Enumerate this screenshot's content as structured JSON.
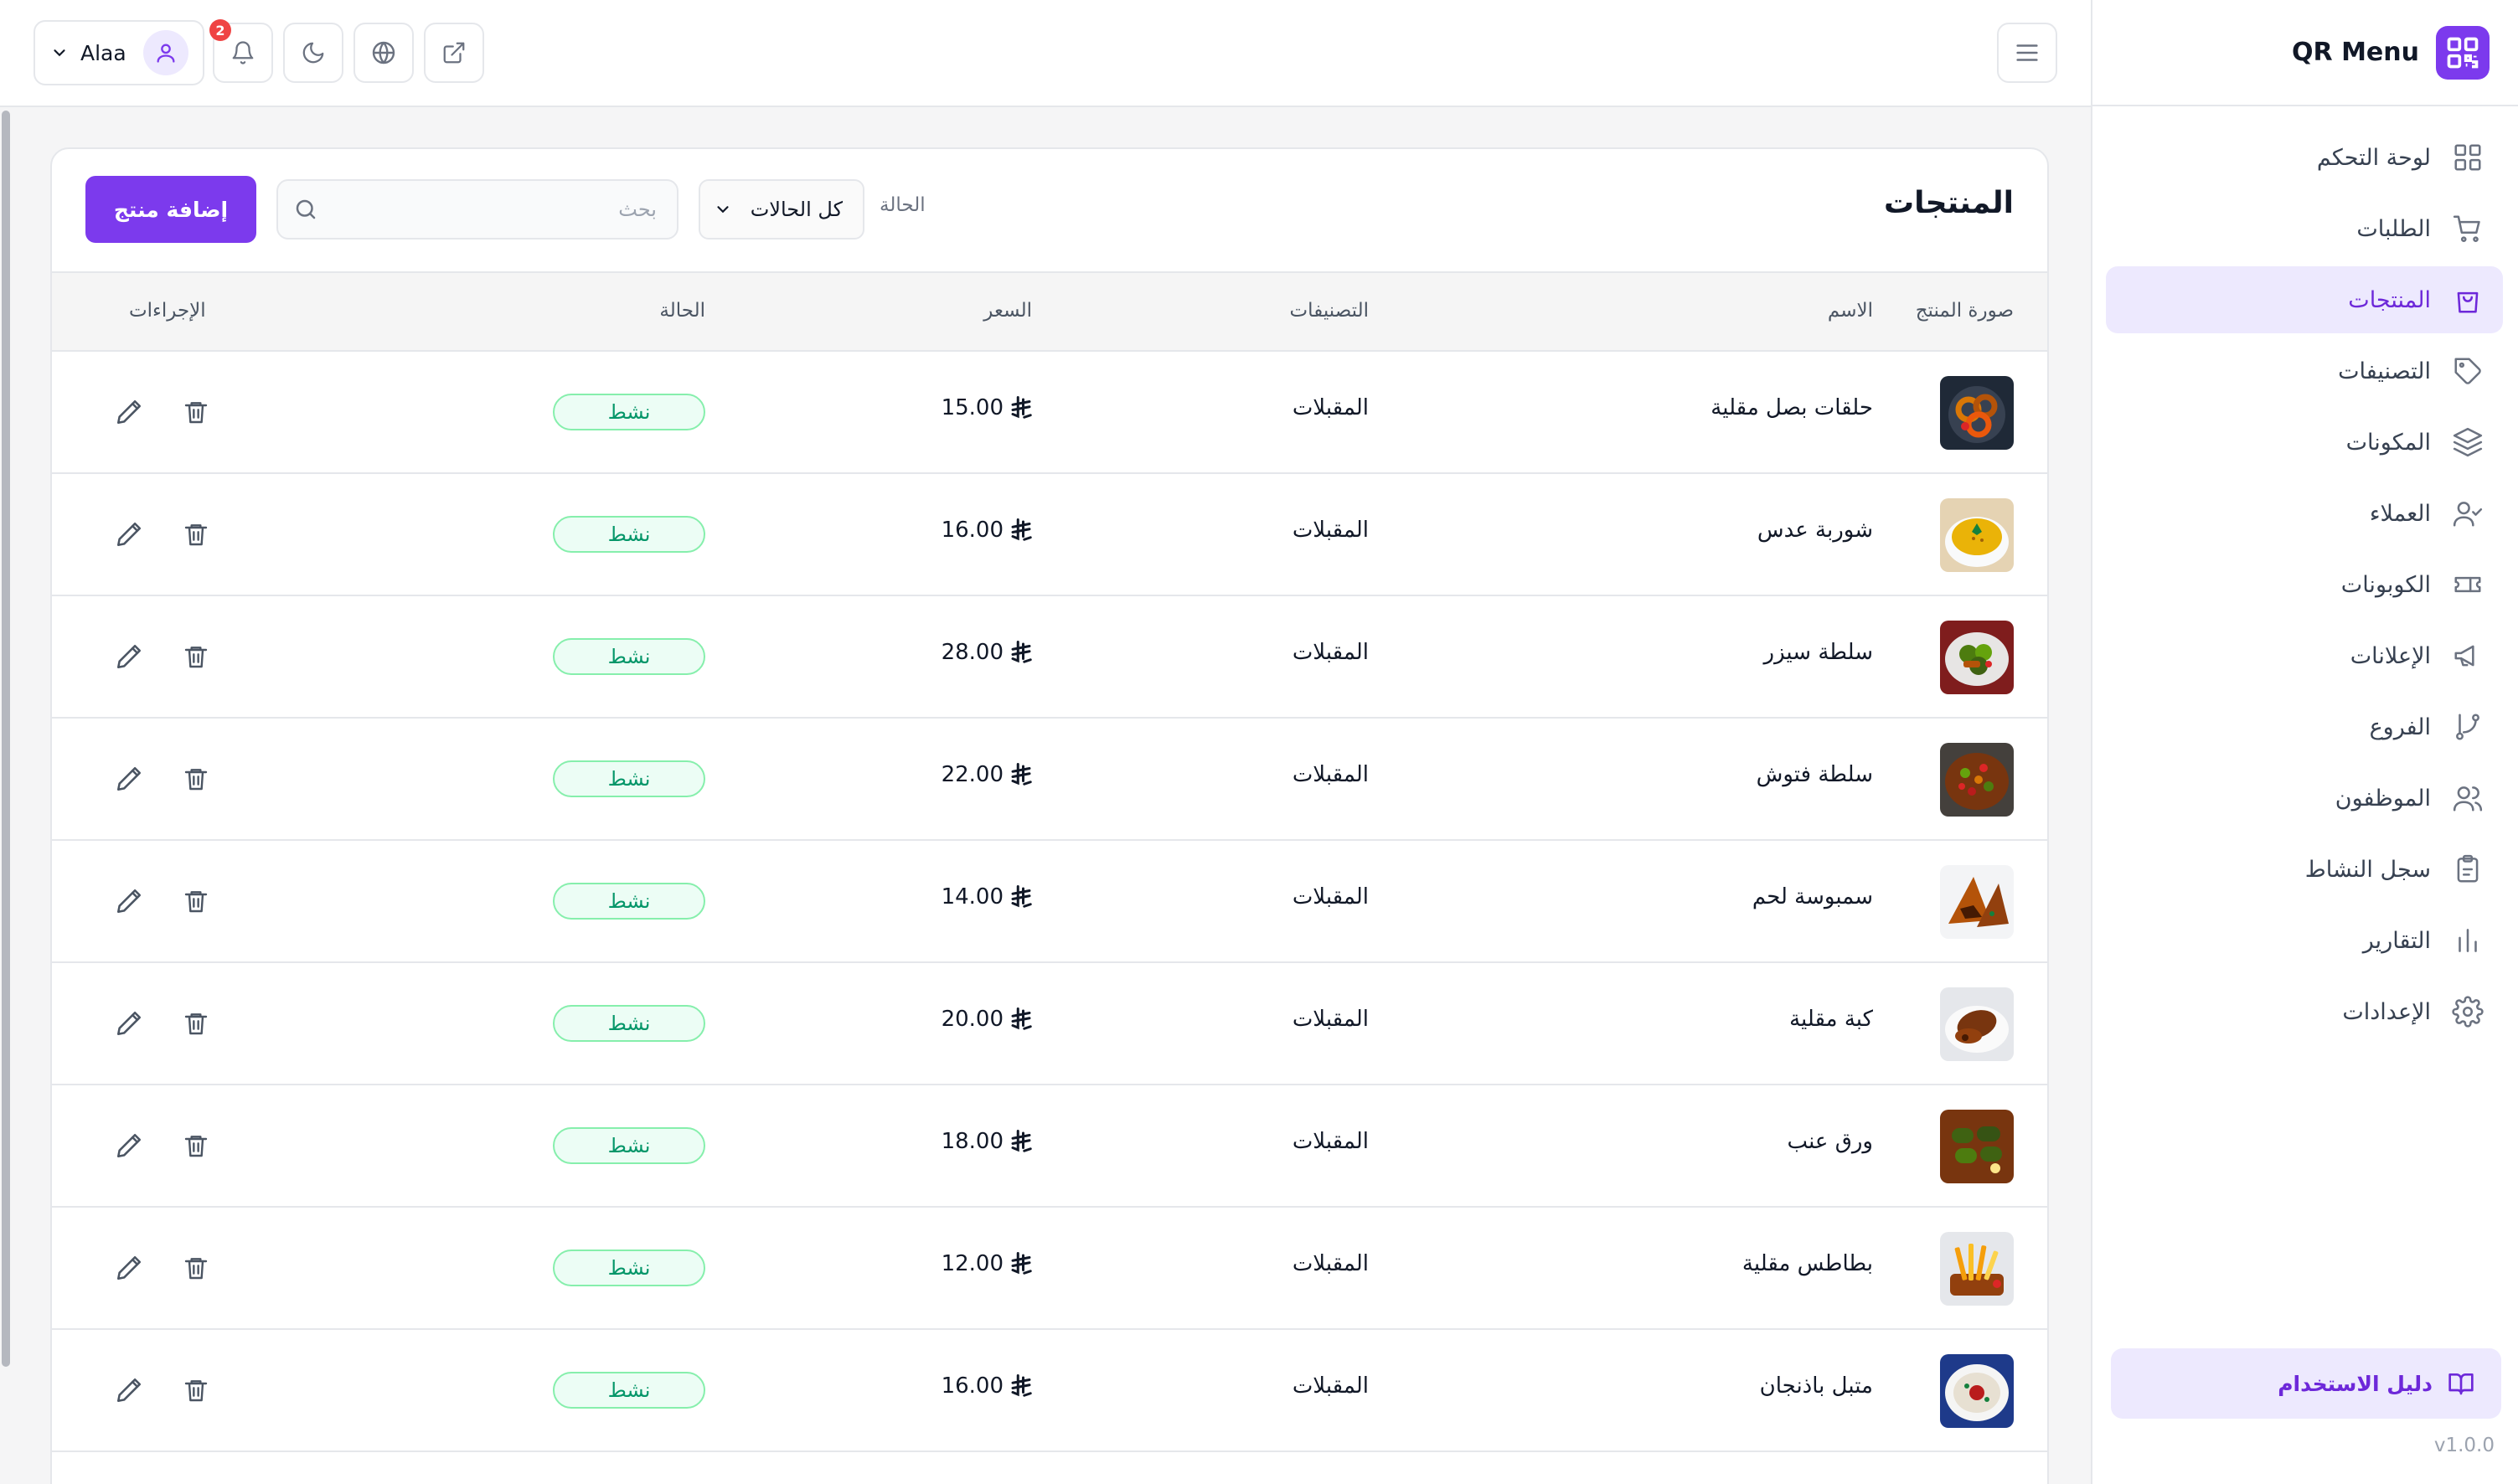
{
  "brand": {
    "name": "QR Menu",
    "logo_icon": "qr-code-icon",
    "accent": "#7c3aed"
  },
  "sidebar": {
    "items": [
      {
        "label": "لوحة التحكم",
        "icon": "grid-icon",
        "active": false
      },
      {
        "label": "الطلبات",
        "icon": "cart-icon",
        "active": false
      },
      {
        "label": "المنتجات",
        "icon": "shopping-bag-icon",
        "active": true
      },
      {
        "label": "التصنيفات",
        "icon": "tag-icon",
        "active": false
      },
      {
        "label": "المكونات",
        "icon": "layers-icon",
        "active": false
      },
      {
        "label": "العملاء",
        "icon": "user-check-icon",
        "active": false
      },
      {
        "label": "الكوبونات",
        "icon": "ticket-icon",
        "active": false
      },
      {
        "label": "الإعلانات",
        "icon": "megaphone-icon",
        "active": false
      },
      {
        "label": "الفروع",
        "icon": "git-branch-icon",
        "active": false
      },
      {
        "label": "الموظفون",
        "icon": "users-icon",
        "active": false
      },
      {
        "label": "سجل النشاط",
        "icon": "clipboard-icon",
        "active": false
      },
      {
        "label": "التقارير",
        "icon": "bar-chart-icon",
        "active": false
      },
      {
        "label": "الإعدادات",
        "icon": "settings-icon",
        "active": false
      }
    ],
    "guide_label": "دليل الاستخدام",
    "version": "v1.0.0"
  },
  "topbar": {
    "user_name": "Alaa",
    "notification_count": "2"
  },
  "products": {
    "title": "المنتجات",
    "filter_label": "الحالة",
    "filter_value": "كل الحالات",
    "search_placeholder": "بحث",
    "add_button": "إضافة منتج",
    "columns": {
      "image": "صورة المنتج",
      "name": "الاسم",
      "category": "التصنيفات",
      "price": "السعر",
      "status": "الحالة",
      "actions": "الإجراءات"
    },
    "rows": [
      {
        "name": "حلقات بصل مقلية",
        "category": "المقبلات",
        "price": "15.00",
        "status": "نشط",
        "food": "onion-rings"
      },
      {
        "name": "شوربة عدس",
        "category": "المقبلات",
        "price": "16.00",
        "status": "نشط",
        "food": "soup"
      },
      {
        "name": "سلطة سيزر",
        "category": "المقبلات",
        "price": "28.00",
        "status": "نشط",
        "food": "salad"
      },
      {
        "name": "سلطة فتوش",
        "category": "المقبلات",
        "price": "22.00",
        "status": "نشط",
        "food": "fattoush"
      },
      {
        "name": "سمبوسة لحم",
        "category": "المقبلات",
        "price": "14.00",
        "status": "نشط",
        "food": "samosa"
      },
      {
        "name": "كبة مقلية",
        "category": "المقبلات",
        "price": "20.00",
        "status": "نشط",
        "food": "kibbeh"
      },
      {
        "name": "ورق عنب",
        "category": "المقبلات",
        "price": "18.00",
        "status": "نشط",
        "food": "grape-leaves"
      },
      {
        "name": "بطاطس مقلية",
        "category": "المقبلات",
        "price": "12.00",
        "status": "نشط",
        "food": "fries"
      },
      {
        "name": "متبل باذنجان",
        "category": "المقبلات",
        "price": "16.00",
        "status": "نشط",
        "food": "mutabal"
      }
    ]
  }
}
